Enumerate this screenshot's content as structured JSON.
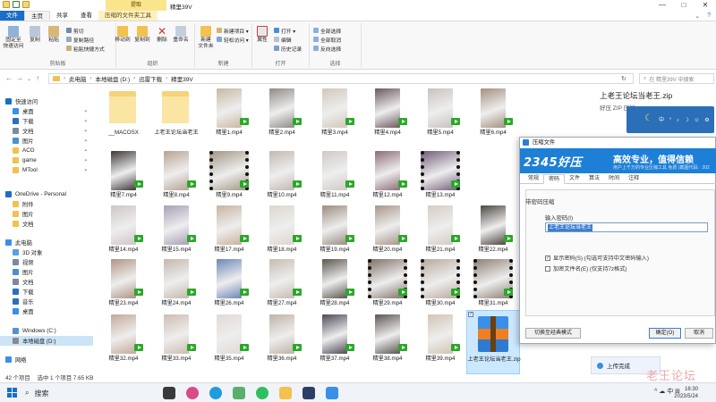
{
  "window": {
    "context_tab": "提取",
    "title": "精里39V",
    "controls": [
      "—",
      "□",
      "✕"
    ]
  },
  "ribbon_tabs": [
    {
      "label": "文件"
    },
    {
      "label": "主页"
    },
    {
      "label": "共享"
    },
    {
      "label": "查看"
    },
    {
      "label": "压缩的文件夹工具"
    }
  ],
  "ribbon": {
    "groups": {
      "clipboard": {
        "label": "剪贴板",
        "pin_label_1": "固定至",
        "pin_label_2": "快速访问",
        "copy": "复制",
        "paste": "粘贴",
        "cut": "剪切",
        "copy_path": "复制路径",
        "paste_shortcut": "粘贴快捷方式"
      },
      "organize": {
        "label": "组织",
        "move_to": "移动到",
        "copy_to": "复制到",
        "delete": "删除",
        "rename": "重命名"
      },
      "new": {
        "label": "新建",
        "new_folder_1": "新建",
        "new_folder_2": "文件夹",
        "new_item": "新建项目 ▾",
        "easy_access": "轻松访问 ▾"
      },
      "open": {
        "label": "打开",
        "properties": "属性",
        "open": "打开 ▾",
        "edit": "编辑",
        "history": "历史记录"
      },
      "select": {
        "label": "选择",
        "select_all": "全部选择",
        "select_none": "全部取消",
        "invert": "反向选择"
      }
    }
  },
  "address": {
    "crumbs": [
      "此电脑",
      "本地磁盘 (D:)",
      "迅雷下载",
      "精里39V"
    ],
    "search_placeholder": "在 精里39V 中搜索"
  },
  "nav": {
    "items": [
      {
        "label": "快速访问",
        "color": "#1a6ec7"
      },
      {
        "label": "桌面",
        "color": "#3a8fe8",
        "pinned": true
      },
      {
        "label": "下载",
        "color": "#2b6fbe",
        "pinned": true
      },
      {
        "label": "文档",
        "color": "#7a8aa0",
        "pinned": true
      },
      {
        "label": "图片",
        "color": "#4a90d0",
        "pinned": true
      },
      {
        "label": "ACG",
        "color": "#f2c14e",
        "pinned": true
      },
      {
        "label": "game",
        "color": "#f2c14e",
        "pinned": true
      },
      {
        "label": "MTool",
        "color": "#f2c14e",
        "pinned": true
      },
      {
        "label": "OneDrive - Personal",
        "color": "#1a6ec7"
      },
      {
        "label": "附件",
        "color": "#f2c14e"
      },
      {
        "label": "图片",
        "color": "#f2c14e"
      },
      {
        "label": "文档",
        "color": "#f2c14e"
      },
      {
        "label": "此电脑",
        "color": "#3a8fe8"
      },
      {
        "label": "3D 对象",
        "color": "#5aa0e0"
      },
      {
        "label": "视频",
        "color": "#7a8aa0"
      },
      {
        "label": "图片",
        "color": "#4a90d0"
      },
      {
        "label": "文档",
        "color": "#7a8aa0"
      },
      {
        "label": "下载",
        "color": "#2b6fbe"
      },
      {
        "label": "音乐",
        "color": "#2b6fbe"
      },
      {
        "label": "桌面",
        "color": "#3a8fe8"
      },
      {
        "label": "Windows (C:)",
        "color": "#5a8fd0"
      },
      {
        "label": "本地磁盘 (D:)",
        "color": "#8a8a8a",
        "selected": true
      },
      {
        "label": "网络",
        "color": "#3a8fe8"
      }
    ]
  },
  "files": [
    {
      "name": "__MACOSX",
      "kind": "folder"
    },
    {
      "name": "上老王论坛当老王",
      "kind": "folder"
    },
    {
      "name": "精里1.mp4",
      "kind": "video",
      "tone": "#c9b9a5"
    },
    {
      "name": "精里2.mp4",
      "kind": "video",
      "tone": "#8e8a86"
    },
    {
      "name": "精里3.mp4",
      "kind": "video",
      "tone": "#d2c7bc"
    },
    {
      "name": "精里4.mp4",
      "kind": "video",
      "tone": "#6b5860"
    },
    {
      "name": "精里5.mp4",
      "kind": "video",
      "tone": "#c8c2bf"
    },
    {
      "name": "精里6.mp4",
      "kind": "video",
      "tone": "#a59080"
    },
    {
      "name": "精里7.mp4",
      "kind": "video",
      "tone": "#3e3837"
    },
    {
      "name": "精里8.mp4",
      "kind": "video",
      "tone": "#b7a394"
    },
    {
      "name": "精里9.mp4",
      "kind": "video",
      "tone": "#a09582",
      "film": true
    },
    {
      "name": "精里10.mp4",
      "kind": "video",
      "tone": "#c3b8af"
    },
    {
      "name": "精里11.mp4",
      "kind": "video",
      "tone": "#cfc9c5"
    },
    {
      "name": "精里12.mp4",
      "kind": "video",
      "tone": "#8d6c7a"
    },
    {
      "name": "精里13.mp4",
      "kind": "video",
      "tone": "#6f5a78",
      "film": true
    },
    {
      "name": "精里14.mp4",
      "kind": "video",
      "tone": "#cfc6c6"
    },
    {
      "name": "精里15.mp4",
      "kind": "video",
      "tone": "#a8a0b8"
    },
    {
      "name": "精里17.mp4",
      "kind": "video",
      "tone": "#c9b3a0"
    },
    {
      "name": "精里18.mp4",
      "kind": "video",
      "tone": "#ddd6cf"
    },
    {
      "name": "精里19.mp4",
      "kind": "video",
      "tone": "#9c8c80"
    },
    {
      "name": "精里20.mp4",
      "kind": "video",
      "tone": "#a8968a"
    },
    {
      "name": "精里21.mp4",
      "kind": "video",
      "tone": "#d4ccc4"
    },
    {
      "name": "精里22.mp4",
      "kind": "video",
      "tone": "#4c4640"
    },
    {
      "name": "精里23.mp4",
      "kind": "video",
      "tone": "#b09484"
    },
    {
      "name": "精里24.mp4",
      "kind": "video",
      "tone": "#c4b8ae"
    },
    {
      "name": "精里26.mp4",
      "kind": "video",
      "tone": "#6d86b8"
    },
    {
      "name": "精里27.mp4",
      "kind": "video",
      "tone": "#c7bcb2"
    },
    {
      "name": "精里28.mp4",
      "kind": "video",
      "tone": "#5c564e"
    },
    {
      "name": "精里29.mp4",
      "kind": "video",
      "tone": "#7d6e64",
      "film": true
    },
    {
      "name": "精里30.mp4",
      "kind": "video",
      "tone": "#b8a89a",
      "film": true
    },
    {
      "name": "精里31.mp4",
      "kind": "video",
      "tone": "#8b7d70",
      "film": true
    },
    {
      "name": "精里32.mp4",
      "kind": "video",
      "tone": "#c4a89a"
    },
    {
      "name": "精里33.mp4",
      "kind": "video",
      "tone": "#cdbdb0"
    },
    {
      "name": "精里35.mp4",
      "kind": "video",
      "tone": "#e0dad6"
    },
    {
      "name": "精里36.mp4",
      "kind": "video",
      "tone": "#bfb3a6"
    },
    {
      "name": "精里37.mp4",
      "kind": "video",
      "tone": "#4f4857"
    },
    {
      "name": "精里38.mp4",
      "kind": "video",
      "tone": "#5b5552"
    },
    {
      "name": "精里39.mp4",
      "kind": "video",
      "tone": "#d2c4b5"
    },
    {
      "name": "上老王论坛当老王.zip",
      "kind": "zip",
      "selected": true
    }
  ],
  "status": {
    "count": "42 个项目",
    "selection": "选中 1 个项目  7.65 KB"
  },
  "preview": {
    "title": "上老王论坛当老王.zip",
    "subtitle": "好压 ZIP 压缩...",
    "moon": "☾",
    "banner_chars": "中 ° ♪ ☽ ☺ ⚙",
    "upload": "上传完成",
    "watermark": "老王论坛"
  },
  "dialog": {
    "title": "压缩文件",
    "banner_logo": "2345好压",
    "banner_slogan": "高效专业，值得信赖",
    "banner_small": "用户上千万的专业压缩工具 免费 (截图代码：202",
    "tabs": [
      "常规",
      "密码",
      "文件",
      "算法",
      "时间",
      "注释"
    ],
    "active_tab": 1,
    "section": "带密码压缩",
    "password_label": "输入密码(I)",
    "password_value": "上老王论坛当老王",
    "checks": [
      {
        "label": "显示密码(S)  (勾选可支持中文密码输入)",
        "checked": true
      },
      {
        "label": "加密文件名(E)  (仅支持7z格式)",
        "checked": false
      }
    ],
    "btn_advanced": "切换至经典模式",
    "btn_ok": "确定(O)",
    "btn_cancel": "取消"
  },
  "taskbar": {
    "search": "搜索",
    "tray": "^  ☁  中  ⊞",
    "time": "16:30",
    "date": "2023/5/24"
  }
}
